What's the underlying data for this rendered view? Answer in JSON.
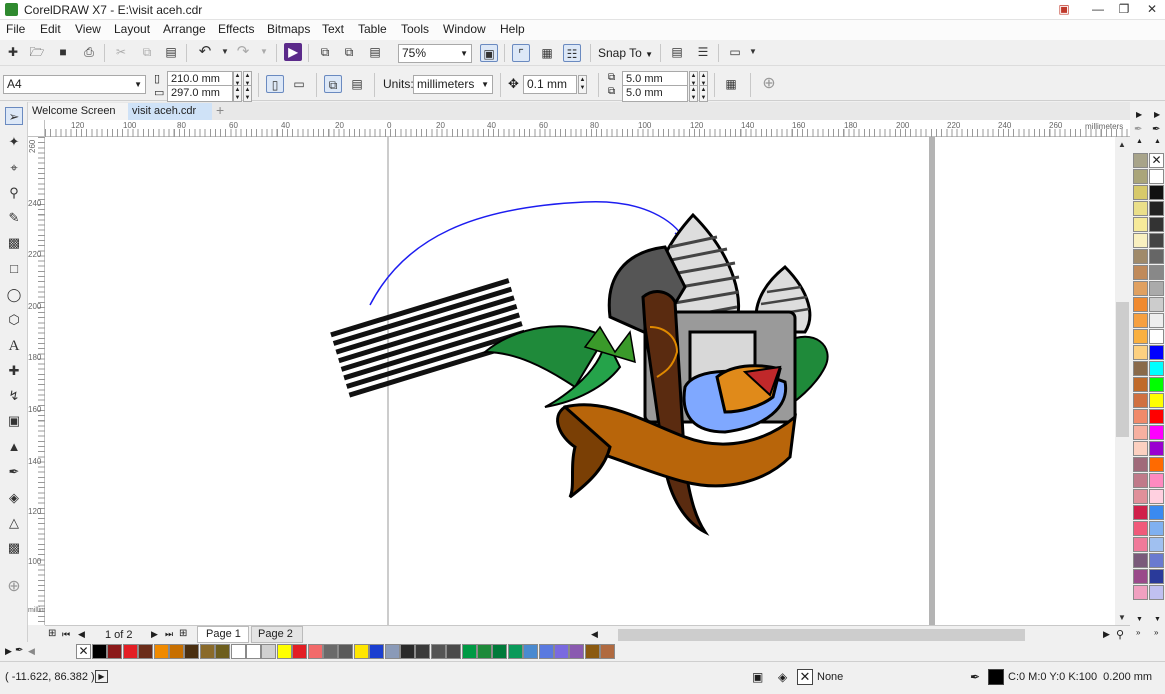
{
  "window": {
    "title": "CorelDRAW X7 - E:\\visit aceh.cdr"
  },
  "menu": [
    "File",
    "Edit",
    "View",
    "Layout",
    "Arrange",
    "Effects",
    "Bitmaps",
    "Text",
    "Table",
    "Tools",
    "Window",
    "Help"
  ],
  "toolbar": {
    "zoom": "75%",
    "snap_to": "Snap To"
  },
  "property_bar": {
    "page_size": "A4",
    "width": "210.0 mm",
    "height": "297.0 mm",
    "units_label": "Units:",
    "units_value": "millimeters",
    "nudge": "0.1 mm",
    "dup_x": "5.0 mm",
    "dup_y": "5.0 mm"
  },
  "tabs": [
    "Welcome Screen",
    "visit aceh.cdr"
  ],
  "ruler": {
    "unit": "millimeters",
    "h_labels": [
      "120",
      "100",
      "80",
      "60",
      "40",
      "20",
      "0",
      "20",
      "40",
      "60",
      "80",
      "100",
      "120",
      "140",
      "160",
      "180",
      "200",
      "220",
      "240",
      "260"
    ],
    "v_labels": [
      "260",
      "240",
      "220",
      "200",
      "180",
      "160",
      "140",
      "120",
      "100"
    ],
    "v_unit": "millimeters"
  },
  "page_nav": {
    "count": "1 of 2",
    "pages": [
      "Page 1",
      "Page 2"
    ]
  },
  "status": {
    "coords": "( -11.622, 86.382 )",
    "fill": "None",
    "outline": "C:0 M:0 Y:0 K:100  0.200 mm"
  },
  "palette_colors": {
    "document": [
      "#000000",
      "#8b1a1a",
      "#e31e24",
      "#6b2d1a",
      "#f08a00",
      "#c76f00",
      "#4a2f10",
      "#8a6a2a",
      "#6d5e1e",
      "#ffffff",
      "#ffffff",
      "#d0d0d0",
      "#ffff00",
      "#e31e24",
      "#f26a6a",
      "#6a6a6a",
      "#5a5a5a",
      "#ffe600",
      "#1b3fd0",
      "#8a9ab8",
      "#2a2a2a",
      "#3a3a3a",
      "#555555",
      "#4a4a4a",
      "#009a44",
      "#1e8a3a",
      "#007a3a",
      "#0a9a5a",
      "#4a8ad0",
      "#5a7ae0",
      "#7a6ae0",
      "#8a5ab0",
      "#8b5a10",
      "#b06a40"
    ],
    "right": [
      "#a8a48a",
      "#000000",
      "#aaa57a",
      "#ffffff",
      "#d7c96a",
      "#111111",
      "#eadf8a",
      "#222222",
      "#f6ea9a",
      "#333333",
      "#f9f0c0",
      "#444444",
      "#a08a6a",
      "#666666",
      "#c08a5a",
      "#888888",
      "#e0a060",
      "#aaaaaa",
      "#f08a30",
      "#cccccc",
      "#f6a040",
      "#eeeeee",
      "#f9b040",
      "#ffffff",
      "#fcd080",
      "#0000ff",
      "#8a6a4a",
      "#00ffff",
      "#c06a2a",
      "#00ff00",
      "#d07040",
      "#ffff00",
      "#f08a6a",
      "#ff0000",
      "#f6b0a0",
      "#ff00ff",
      "#fcd0c0",
      "#9a00d0",
      "#a06a7a",
      "#ff6a00",
      "#c07a8a",
      "#ff8ac0",
      "#e0909a",
      "#ffd0e0",
      "#d0204a",
      "#3a8af0",
      "#f05a7a",
      "#80b0f0",
      "#f07a9a",
      "#a0c0f0",
      "#7a5a7a",
      "#6a7ad0",
      "#9a4a8a",
      "#2a3a9a",
      "#f0a0c0",
      "#c0c0f0"
    ]
  }
}
